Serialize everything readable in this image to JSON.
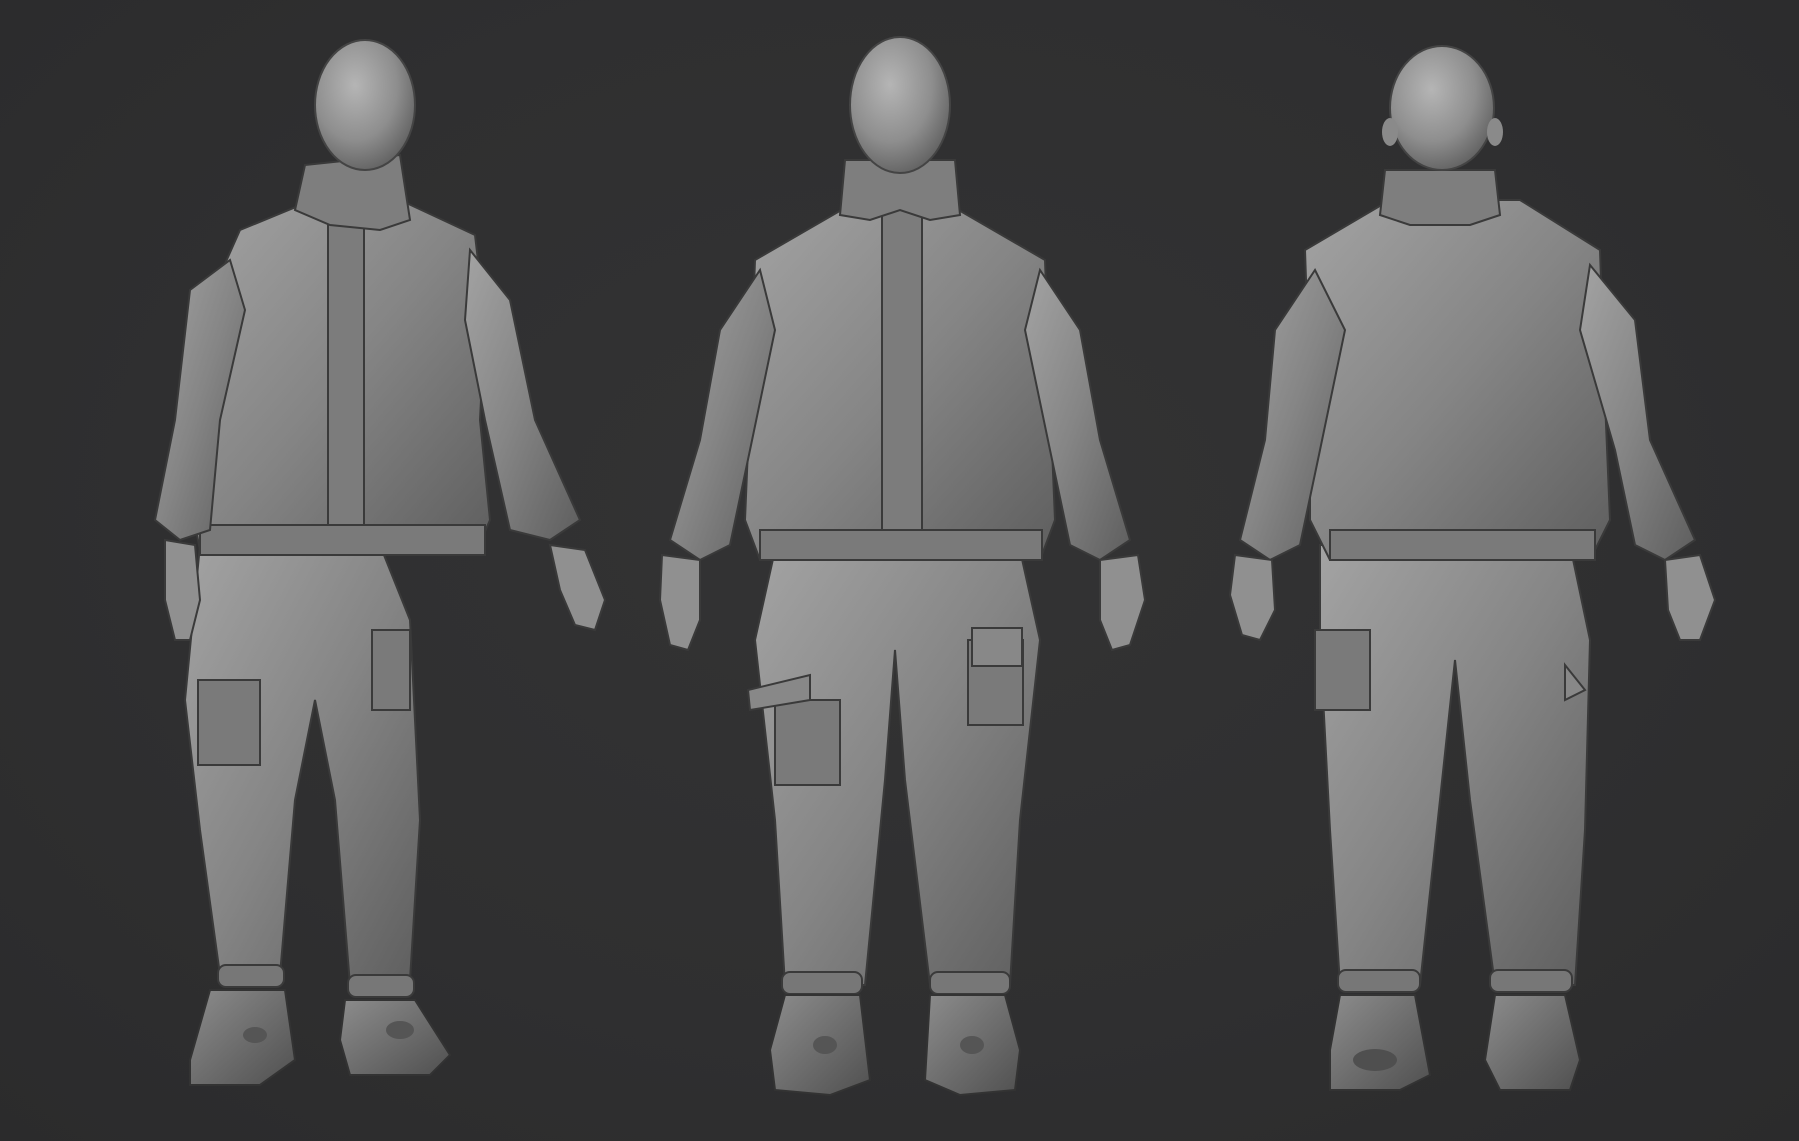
{
  "scene": {
    "background_color": "#2f2f30",
    "material_color": "#8a8a8a",
    "views": [
      {
        "id": "three-quarter",
        "icon": "sculpt-figure-three-quarter"
      },
      {
        "id": "front",
        "icon": "sculpt-figure-front"
      },
      {
        "id": "back",
        "icon": "sculpt-figure-back"
      }
    ]
  }
}
